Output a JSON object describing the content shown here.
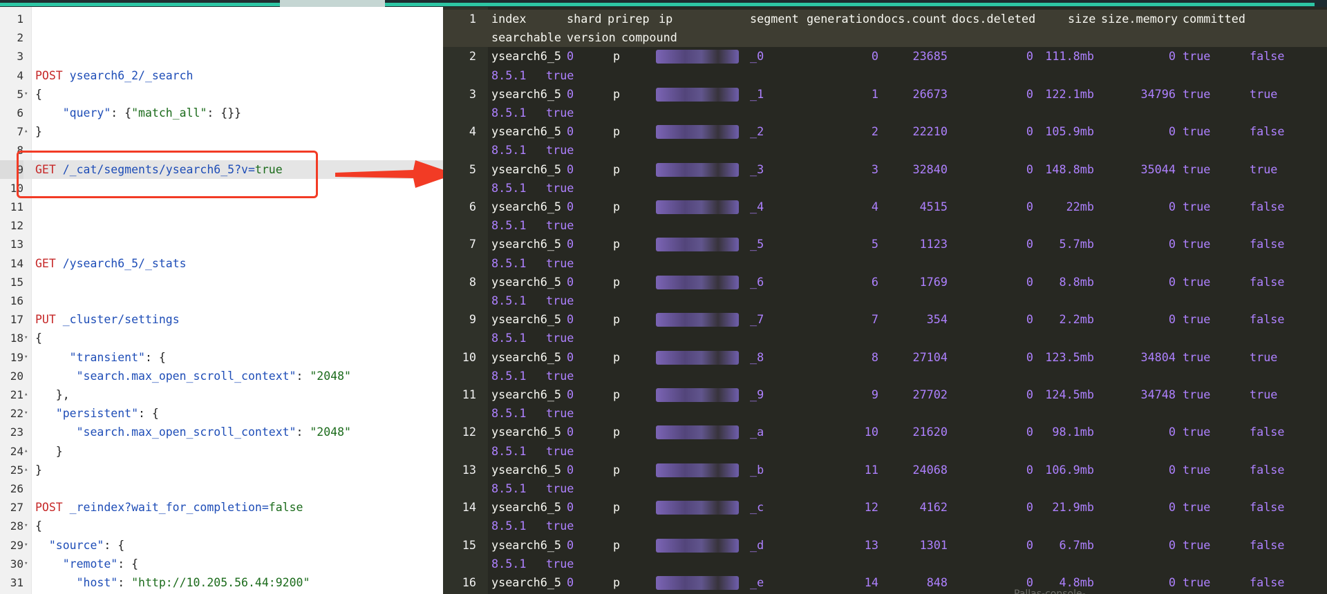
{
  "colors": {
    "accent": "#25a886",
    "editor_bg": "#ffffff",
    "output_bg": "#272822",
    "highlight": "#f23b25"
  },
  "editor": {
    "lines": [
      {
        "n": "1",
        "fold": "",
        "tokens": []
      },
      {
        "n": "2",
        "fold": "",
        "tokens": []
      },
      {
        "n": "3",
        "fold": "",
        "tokens": []
      },
      {
        "n": "4",
        "fold": "",
        "tokens": [
          {
            "c": "kw-post",
            "t": "POST "
          },
          {
            "c": "url",
            "t": "ysearch6_2/_search"
          }
        ]
      },
      {
        "n": "5",
        "fold": "▾",
        "tokens": [
          {
            "c": "plain",
            "t": "{"
          }
        ]
      },
      {
        "n": "6",
        "fold": "",
        "tokens": [
          {
            "c": "plain",
            "t": "    "
          },
          {
            "c": "url",
            "t": "\"query\""
          },
          {
            "c": "plain",
            "t": ": {"
          },
          {
            "c": "str",
            "t": "\"match_all\""
          },
          {
            "c": "plain",
            "t": ": {}}"
          }
        ]
      },
      {
        "n": "7",
        "fold": "▴",
        "tokens": [
          {
            "c": "plain",
            "t": "}"
          }
        ]
      },
      {
        "n": "8",
        "fold": "",
        "tokens": []
      },
      {
        "n": "9",
        "fold": "",
        "hl": true,
        "tokens": [
          {
            "c": "kw-get",
            "t": "GET "
          },
          {
            "c": "url",
            "t": "/_cat/segments/ysearch6_5?v="
          },
          {
            "c": "bool",
            "t": "true"
          }
        ]
      },
      {
        "n": "10",
        "fold": "",
        "tokens": []
      },
      {
        "n": "11",
        "fold": "",
        "tokens": []
      },
      {
        "n": "12",
        "fold": "",
        "tokens": []
      },
      {
        "n": "13",
        "fold": "",
        "tokens": []
      },
      {
        "n": "14",
        "fold": "",
        "tokens": [
          {
            "c": "kw-get",
            "t": "GET "
          },
          {
            "c": "url",
            "t": "/ysearch6_5/_stats"
          }
        ]
      },
      {
        "n": "15",
        "fold": "",
        "tokens": []
      },
      {
        "n": "16",
        "fold": "",
        "tokens": []
      },
      {
        "n": "17",
        "fold": "",
        "tokens": [
          {
            "c": "kw-put",
            "t": "PUT "
          },
          {
            "c": "url",
            "t": "_cluster/settings"
          }
        ]
      },
      {
        "n": "18",
        "fold": "▾",
        "tokens": [
          {
            "c": "plain",
            "t": "{"
          }
        ]
      },
      {
        "n": "19",
        "fold": "▾",
        "tokens": [
          {
            "c": "plain",
            "t": "     "
          },
          {
            "c": "url",
            "t": "\"transient\""
          },
          {
            "c": "plain",
            "t": ": {"
          }
        ]
      },
      {
        "n": "20",
        "fold": "",
        "tokens": [
          {
            "c": "plain",
            "t": "      "
          },
          {
            "c": "url",
            "t": "\"search.max_open_scroll_context\""
          },
          {
            "c": "plain",
            "t": ": "
          },
          {
            "c": "str",
            "t": "\"2048\""
          }
        ]
      },
      {
        "n": "21",
        "fold": "▴",
        "tokens": [
          {
            "c": "plain",
            "t": "   },"
          }
        ]
      },
      {
        "n": "22",
        "fold": "▾",
        "tokens": [
          {
            "c": "plain",
            "t": "   "
          },
          {
            "c": "url",
            "t": "\"persistent\""
          },
          {
            "c": "plain",
            "t": ": {"
          }
        ]
      },
      {
        "n": "23",
        "fold": "",
        "tokens": [
          {
            "c": "plain",
            "t": "      "
          },
          {
            "c": "url",
            "t": "\"search.max_open_scroll_context\""
          },
          {
            "c": "plain",
            "t": ": "
          },
          {
            "c": "str",
            "t": "\"2048\""
          }
        ]
      },
      {
        "n": "24",
        "fold": "▴",
        "tokens": [
          {
            "c": "plain",
            "t": "   }"
          }
        ]
      },
      {
        "n": "25",
        "fold": "▴",
        "tokens": [
          {
            "c": "plain",
            "t": "}"
          }
        ]
      },
      {
        "n": "26",
        "fold": "",
        "tokens": []
      },
      {
        "n": "27",
        "fold": "",
        "tokens": [
          {
            "c": "kw-post",
            "t": "POST "
          },
          {
            "c": "url",
            "t": "_reindex?wait_for_completion="
          },
          {
            "c": "bool",
            "t": "false"
          }
        ]
      },
      {
        "n": "28",
        "fold": "▾",
        "tokens": [
          {
            "c": "plain",
            "t": "{"
          }
        ]
      },
      {
        "n": "29",
        "fold": "▾",
        "tokens": [
          {
            "c": "plain",
            "t": "  "
          },
          {
            "c": "url",
            "t": "\"source\""
          },
          {
            "c": "plain",
            "t": ": {"
          }
        ]
      },
      {
        "n": "30",
        "fold": "▾",
        "tokens": [
          {
            "c": "plain",
            "t": "    "
          },
          {
            "c": "url",
            "t": "\"remote\""
          },
          {
            "c": "plain",
            "t": ": {"
          }
        ]
      },
      {
        "n": "31",
        "fold": "",
        "tokens": [
          {
            "c": "plain",
            "t": "      "
          },
          {
            "c": "url",
            "t": "\"host\""
          },
          {
            "c": "plain",
            "t": ": "
          },
          {
            "c": "str",
            "t": "\"http://10.205.56.44:9200\""
          }
        ]
      }
    ]
  },
  "output": {
    "header": {
      "n": "1",
      "row1": [
        "index",
        "shard",
        "prirep",
        "ip",
        "segment",
        "generation",
        "docs.count",
        "docs.deleted",
        "size",
        "size.memory",
        "committed"
      ],
      "row2": [
        "searchable",
        "version",
        "compound"
      ]
    },
    "rows": [
      {
        "n": "2",
        "index": "ysearch6_5",
        "shard": "0",
        "prirep": "p",
        "ip": "10.141.1..22",
        "segment": "_0",
        "generation": "0",
        "docs_count": "23685",
        "docs_deleted": "0",
        "size": "111.8mb",
        "size_memory": "0",
        "committed": "true",
        "searchable": "false",
        "version": "8.5.1",
        "compound": "true"
      },
      {
        "n": "3",
        "index": "ysearch6_5",
        "shard": "0",
        "prirep": "p",
        "ip": "10.141.1..22",
        "segment": "_1",
        "generation": "1",
        "docs_count": "26673",
        "docs_deleted": "0",
        "size": "122.1mb",
        "size_memory": "34796",
        "committed": "true",
        "searchable": "true",
        "version": "8.5.1",
        "compound": "true"
      },
      {
        "n": "4",
        "index": "ysearch6_5",
        "shard": "0",
        "prirep": "p",
        "ip": "10.141.1..22",
        "segment": "_2",
        "generation": "2",
        "docs_count": "22210",
        "docs_deleted": "0",
        "size": "105.9mb",
        "size_memory": "0",
        "committed": "true",
        "searchable": "false",
        "version": "8.5.1",
        "compound": "true"
      },
      {
        "n": "5",
        "index": "ysearch6_5",
        "shard": "0",
        "prirep": "p",
        "ip": "10.141.1..22",
        "segment": "_3",
        "generation": "3",
        "docs_count": "32840",
        "docs_deleted": "0",
        "size": "148.8mb",
        "size_memory": "35044",
        "committed": "true",
        "searchable": "true",
        "version": "8.5.1",
        "compound": "true"
      },
      {
        "n": "6",
        "index": "ysearch6_5",
        "shard": "0",
        "prirep": "p",
        "ip": "10.141.1..22",
        "segment": "_4",
        "generation": "4",
        "docs_count": "4515",
        "docs_deleted": "0",
        "size": "22mb",
        "size_memory": "0",
        "committed": "true",
        "searchable": "false",
        "version": "8.5.1",
        "compound": "true"
      },
      {
        "n": "7",
        "index": "ysearch6_5",
        "shard": "0",
        "prirep": "p",
        "ip": "10.141.1..22",
        "segment": "_5",
        "generation": "5",
        "docs_count": "1123",
        "docs_deleted": "0",
        "size": "5.7mb",
        "size_memory": "0",
        "committed": "true",
        "searchable": "false",
        "version": "8.5.1",
        "compound": "true"
      },
      {
        "n": "8",
        "index": "ysearch6_5",
        "shard": "0",
        "prirep": "p",
        "ip": "10.141.1..22",
        "segment": "_6",
        "generation": "6",
        "docs_count": "1769",
        "docs_deleted": "0",
        "size": "8.8mb",
        "size_memory": "0",
        "committed": "true",
        "searchable": "false",
        "version": "8.5.1",
        "compound": "true"
      },
      {
        "n": "9",
        "index": "ysearch6_5",
        "shard": "0",
        "prirep": "p",
        "ip": "10.141.1..22",
        "segment": "_7",
        "generation": "7",
        "docs_count": "354",
        "docs_deleted": "0",
        "size": "2.2mb",
        "size_memory": "0",
        "committed": "true",
        "searchable": "false",
        "version": "8.5.1",
        "compound": "true"
      },
      {
        "n": "10",
        "index": "ysearch6_5",
        "shard": "0",
        "prirep": "p",
        "ip": "10.141.1..22",
        "segment": "_8",
        "generation": "8",
        "docs_count": "27104",
        "docs_deleted": "0",
        "size": "123.5mb",
        "size_memory": "34804",
        "committed": "true",
        "searchable": "true",
        "version": "8.5.1",
        "compound": "true"
      },
      {
        "n": "11",
        "index": "ysearch6_5",
        "shard": "0",
        "prirep": "p",
        "ip": "10.141.1..22",
        "segment": "_9",
        "generation": "9",
        "docs_count": "27702",
        "docs_deleted": "0",
        "size": "124.5mb",
        "size_memory": "34748",
        "committed": "true",
        "searchable": "true",
        "version": "8.5.1",
        "compound": "true"
      },
      {
        "n": "12",
        "index": "ysearch6_5",
        "shard": "0",
        "prirep": "p",
        "ip": "10.141.1..22",
        "segment": "_a",
        "generation": "10",
        "docs_count": "21620",
        "docs_deleted": "0",
        "size": "98.1mb",
        "size_memory": "0",
        "committed": "true",
        "searchable": "false",
        "version": "8.5.1",
        "compound": "true"
      },
      {
        "n": "13",
        "index": "ysearch6_5",
        "shard": "0",
        "prirep": "p",
        "ip": "10.141.1..22",
        "segment": "_b",
        "generation": "11",
        "docs_count": "24068",
        "docs_deleted": "0",
        "size": "106.9mb",
        "size_memory": "0",
        "committed": "true",
        "searchable": "false",
        "version": "8.5.1",
        "compound": "true"
      },
      {
        "n": "14",
        "index": "ysearch6_5",
        "shard": "0",
        "prirep": "p",
        "ip": "10.141.1..22",
        "segment": "_c",
        "generation": "12",
        "docs_count": "4162",
        "docs_deleted": "0",
        "size": "21.9mb",
        "size_memory": "0",
        "committed": "true",
        "searchable": "false",
        "version": "8.5.1",
        "compound": "true"
      },
      {
        "n": "15",
        "index": "ysearch6_5",
        "shard": "0",
        "prirep": "p",
        "ip": "10.141.1..22",
        "segment": "_d",
        "generation": "13",
        "docs_count": "1301",
        "docs_deleted": "0",
        "size": "6.7mb",
        "size_memory": "0",
        "committed": "true",
        "searchable": "false",
        "version": "8.5.1",
        "compound": "true"
      },
      {
        "n": "16",
        "index": "ysearch6_5",
        "shard": "0",
        "prirep": "p",
        "ip": "10.141.1..22",
        "segment": "_e",
        "generation": "14",
        "docs_count": "848",
        "docs_deleted": "0",
        "size": "4.8mb",
        "size_memory": "0",
        "committed": "true",
        "searchable": "false",
        "version": "8.5.1",
        "compound": "true"
      }
    ],
    "error_icon": "✕",
    "footer_tag": "Pallas-console-..."
  },
  "icons": {
    "error": "close-icon",
    "fold_open": "chevron-down-icon",
    "fold_close": "chevron-up-icon",
    "arrow": "arrow-right-icon"
  }
}
